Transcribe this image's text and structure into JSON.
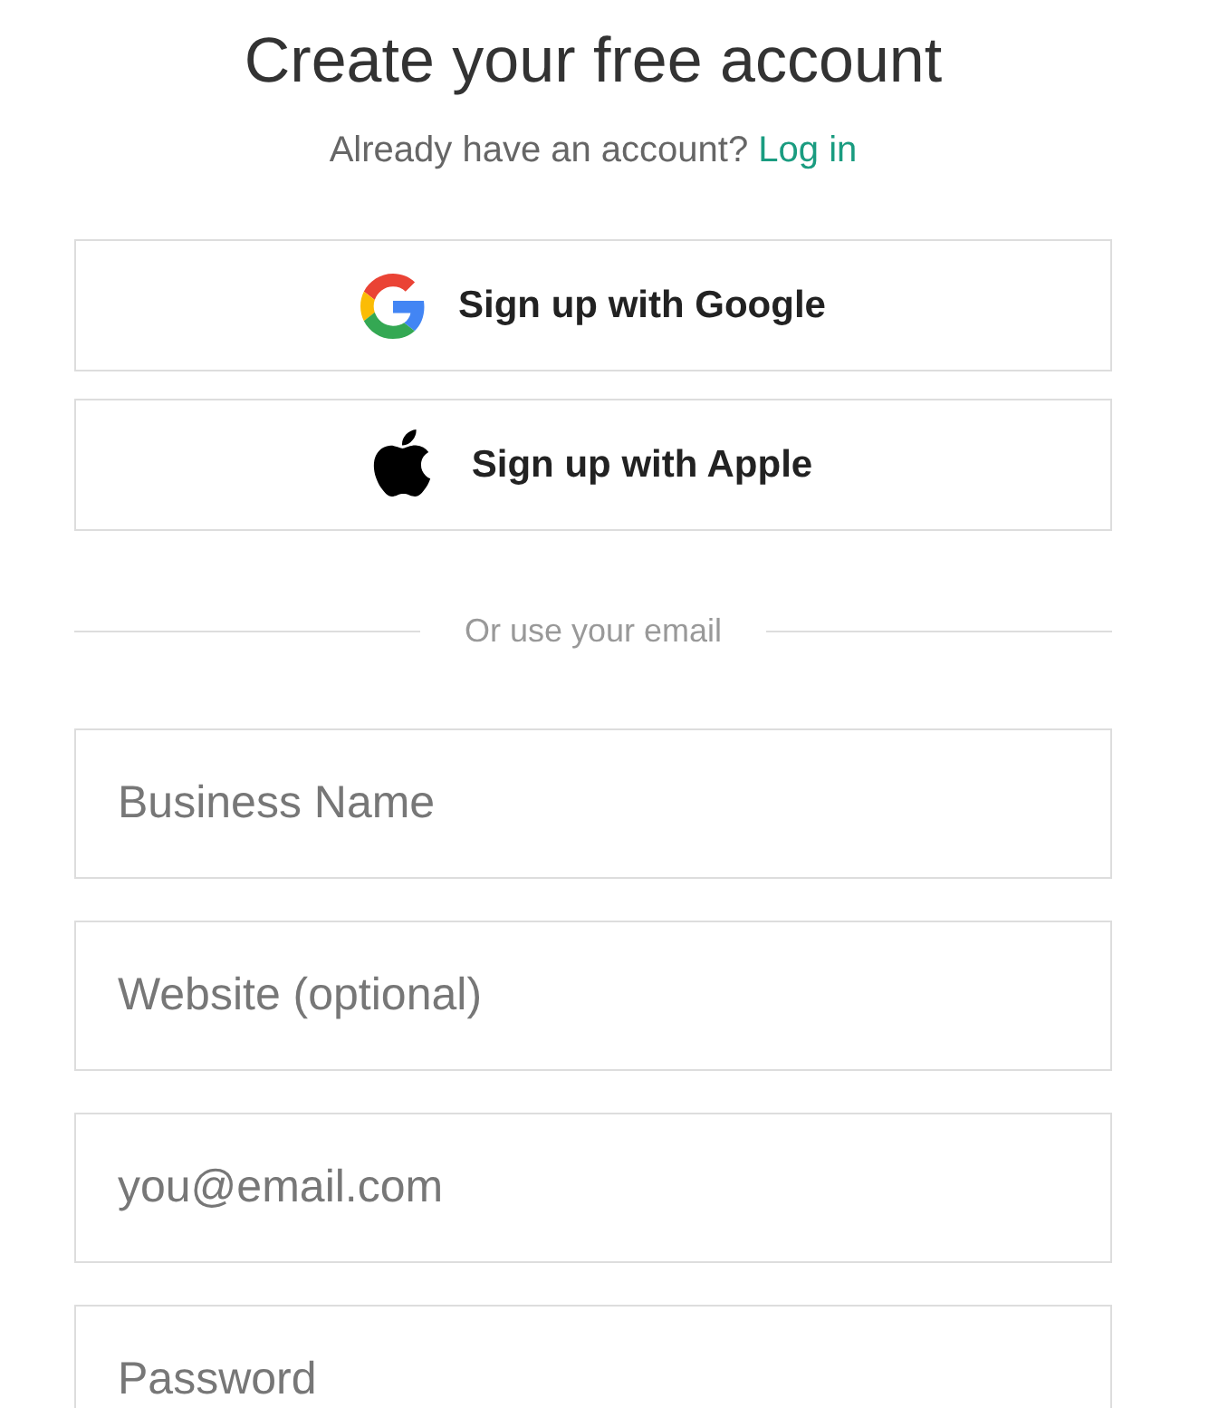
{
  "heading": {
    "title": "Create your free account",
    "prompt": "Already have an account?",
    "link": "Log in"
  },
  "social_buttons": [
    {
      "kind": "google",
      "label": "Sign up with Google"
    },
    {
      "kind": "apple",
      "label": "Sign up with Apple"
    }
  ],
  "divider": {
    "label": "Or use your email"
  },
  "fields": [
    {
      "placeholder": "Business Name"
    },
    {
      "placeholder": "Website (optional)"
    },
    {
      "placeholder": "you@email.com"
    },
    {
      "placeholder": "Password"
    }
  ]
}
